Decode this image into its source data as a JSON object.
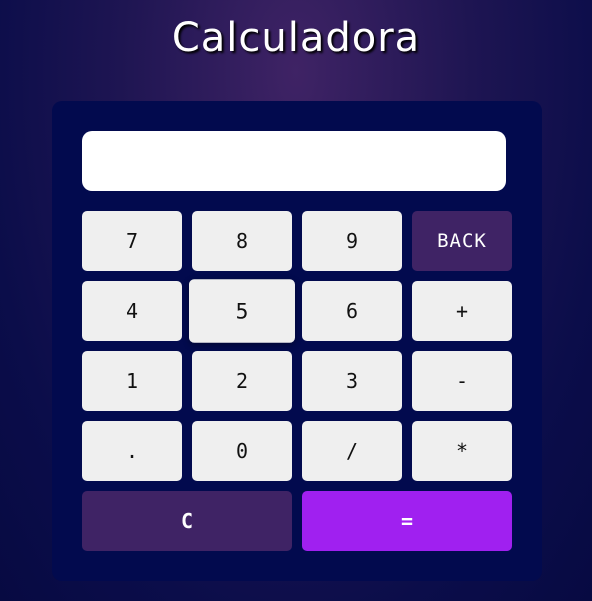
{
  "app": {
    "title": "Calculadora"
  },
  "display": {
    "value": ""
  },
  "keys": {
    "seven": "7",
    "eight": "8",
    "nine": "9",
    "back": "BACK",
    "four": "4",
    "five": "5",
    "six": "6",
    "plus": "+",
    "one": "1",
    "two": "2",
    "three": "3",
    "minus": "-",
    "dot": ".",
    "zero": "0",
    "divide": "/",
    "multiply": "*",
    "clear": "C",
    "equals": "="
  },
  "colors": {
    "panel": "#020a4e",
    "back_key": "#3f2365",
    "clear_key": "#3f2365",
    "equals_key": "#a020f0",
    "digit_key": "#efefef"
  }
}
